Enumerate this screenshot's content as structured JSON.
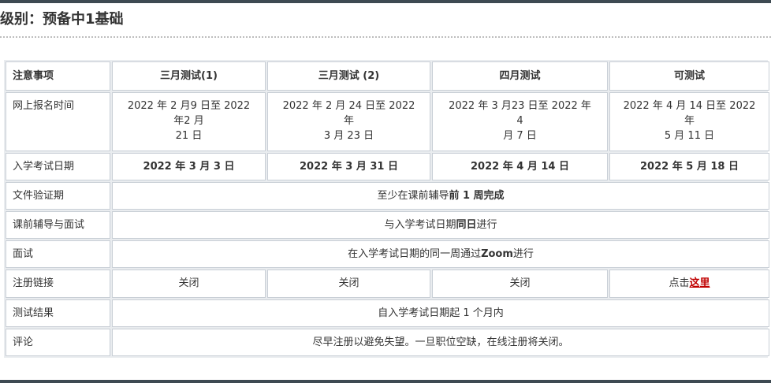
{
  "page": {
    "heading": "级别：预备中1基础"
  },
  "colors": {
    "bar": "#3e4a52",
    "table_bg": "#e9ecef",
    "cell_border": "#c9cfd6",
    "link": "#c00000"
  },
  "table": {
    "headers": [
      "注意事项",
      "三月测试(1)",
      "三月测试 (2)",
      "四月测试",
      "可测试"
    ],
    "registration": {
      "label": "网上报名时间",
      "values": [
        [
          "2022 年 2 月9 日至 2022",
          "年2 月",
          "21 日"
        ],
        [
          "2022 年 2 月 24 日至 2022",
          "年",
          "3 月 23 日"
        ],
        [
          "2022 年 3 月23 日至 2022 年",
          "4",
          "月 7 日"
        ],
        [
          "2022 年 4 月 14 日至 2022",
          "年",
          "5 月 11 日"
        ]
      ]
    },
    "exam_date": {
      "label": "入学考试日期",
      "values": [
        "2022 年 3 月 3 日",
        "2022 年 3 月 31 日",
        "2022 年 4 月 14 日",
        "2022 年 5 月 18 日"
      ]
    },
    "document_verification": {
      "label": "文件验证期",
      "prefix": "至少在课前辅导",
      "bold": "前 1 周完成"
    },
    "pre_course": {
      "label": "课前辅导与面试",
      "prefix": "与入学考试日期",
      "bold": "同日",
      "suffix": "进行"
    },
    "interview": {
      "label": "面试",
      "prefix": "在入学考试日期的同一周通过",
      "bold": "Zoom",
      "suffix": "进行"
    },
    "registration_link": {
      "label": "注册链接",
      "values": [
        "关闭",
        "关闭",
        "关闭"
      ],
      "last_prefix": "点击",
      "last_link": "这里"
    },
    "result": {
      "label": "测试结果",
      "value": "自入学考试日期起 1 个月内"
    },
    "comment": {
      "label": "评论",
      "value": "尽早注册以避免失望。一旦职位空缺，在线注册将关闭。"
    }
  }
}
